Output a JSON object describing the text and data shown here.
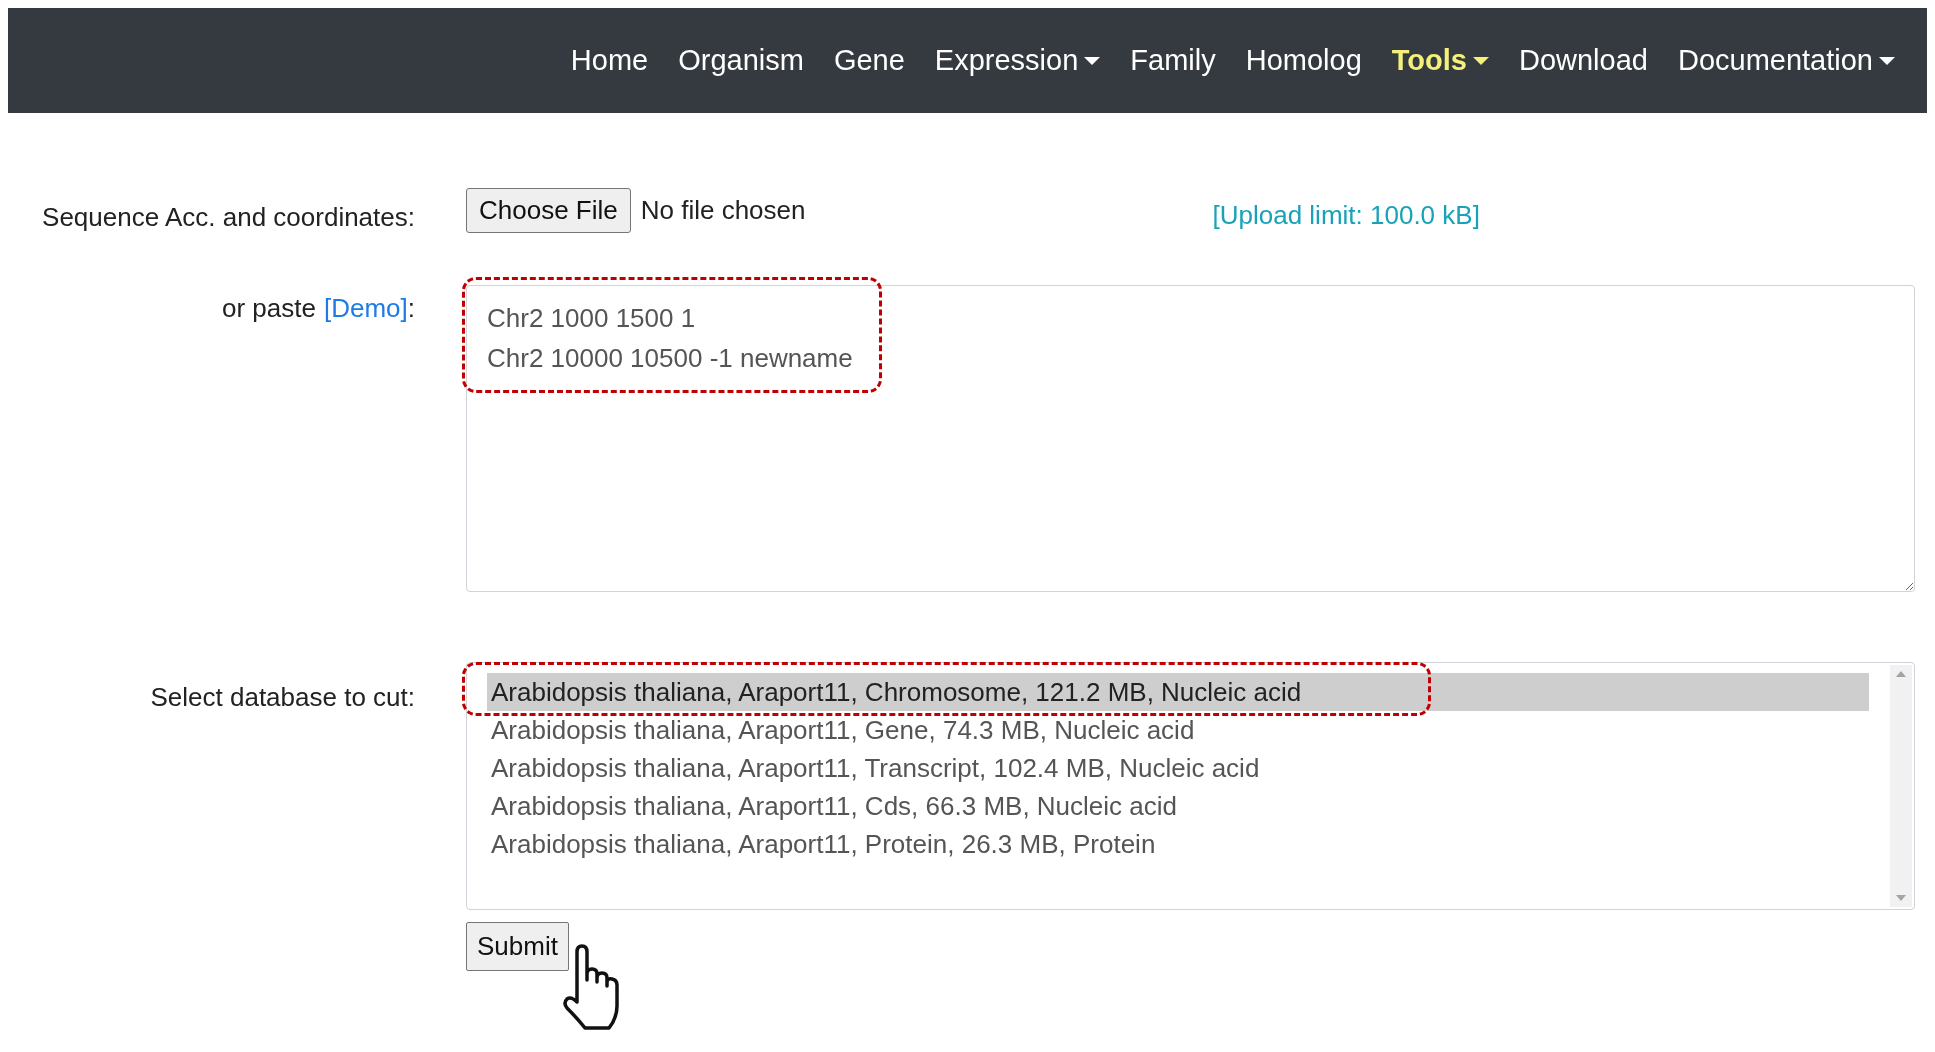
{
  "navbar": {
    "items": [
      {
        "label": "Home",
        "selected": false,
        "dropdown": false
      },
      {
        "label": "Organism",
        "selected": false,
        "dropdown": false
      },
      {
        "label": "Gene",
        "selected": false,
        "dropdown": false
      },
      {
        "label": "Expression",
        "selected": false,
        "dropdown": true
      },
      {
        "label": "Family",
        "selected": false,
        "dropdown": false
      },
      {
        "label": "Homolog",
        "selected": false,
        "dropdown": false
      },
      {
        "label": "Tools",
        "selected": true,
        "dropdown": true
      },
      {
        "label": "Download",
        "selected": false,
        "dropdown": false
      },
      {
        "label": "Documentation",
        "selected": false,
        "dropdown": true
      }
    ]
  },
  "form": {
    "sequence_label": "Sequence Acc. and coordinates:",
    "file_button": "Choose File",
    "file_status": "No file chosen",
    "upload_limit": "[Upload limit: 100.0 kB]",
    "paste_label": "or paste",
    "demo_link": "[Demo]",
    "paste_colon": ":",
    "sequence_text": "Chr2 1000 1500 1\nChr2 10000 10500 -1 newname",
    "database_label": "Select database to cut:",
    "databases": [
      {
        "label": "Arabidopsis thaliana, Araport11, Chromosome, 121.2 MB, Nucleic acid",
        "selected": true
      },
      {
        "label": "Arabidopsis thaliana, Araport11, Gene, 74.3 MB, Nucleic acid",
        "selected": false
      },
      {
        "label": "Arabidopsis thaliana, Araport11, Transcript, 102.4 MB, Nucleic acid",
        "selected": false
      },
      {
        "label": "Arabidopsis thaliana, Araport11, Cds, 66.3 MB, Nucleic acid",
        "selected": false
      },
      {
        "label": "Arabidopsis thaliana, Araport11, Protein, 26.3 MB, Protein",
        "selected": false
      }
    ],
    "submit": "Submit"
  }
}
